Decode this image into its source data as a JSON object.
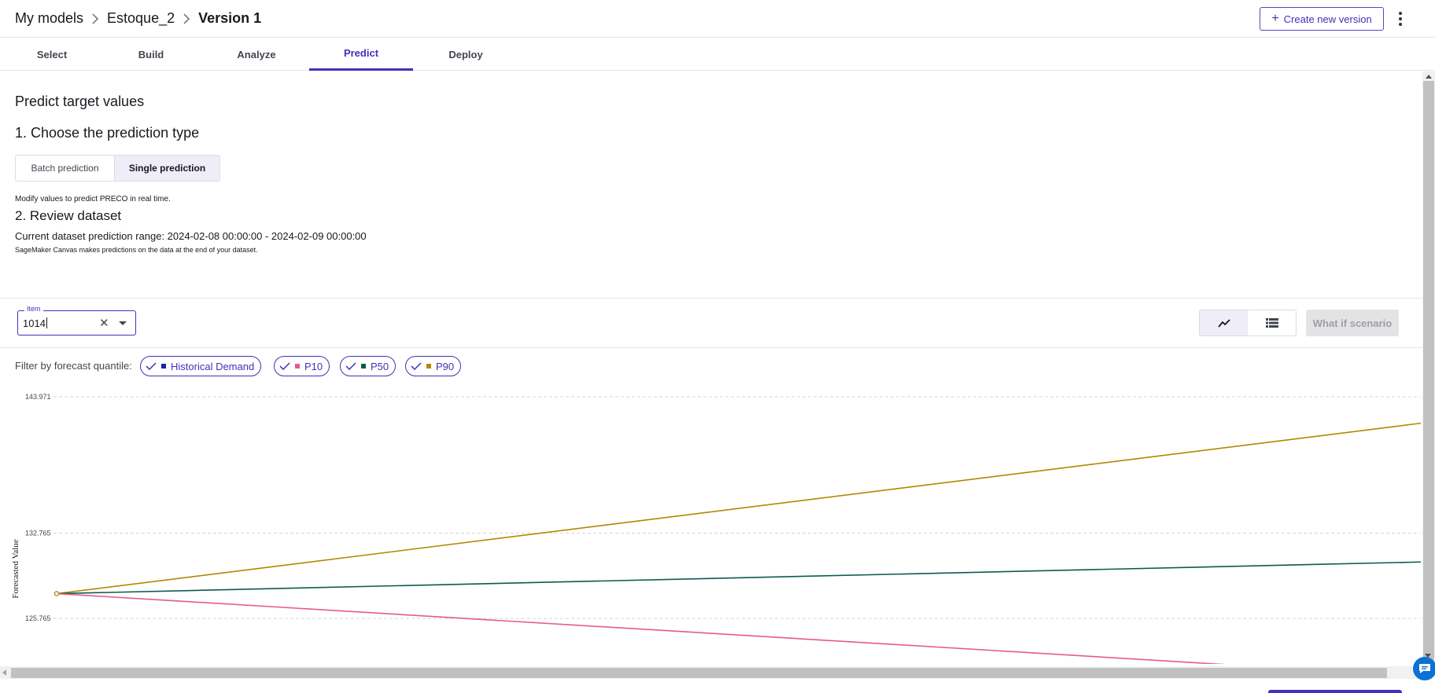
{
  "breadcrumb": {
    "root": "My models",
    "model": "Estoque_2",
    "version": "Version 1"
  },
  "header": {
    "create_button": "Create new version"
  },
  "tabs": [
    {
      "label": "Select"
    },
    {
      "label": "Build"
    },
    {
      "label": "Analyze"
    },
    {
      "label": "Predict",
      "active": true
    },
    {
      "label": "Deploy"
    }
  ],
  "content": {
    "title": "Predict target values",
    "step1": "1. Choose the prediction type",
    "prediction_types": {
      "batch": "Batch prediction",
      "single": "Single prediction",
      "selected": "Single prediction"
    },
    "hint": "Modify values to predict PRECO in real time.",
    "step2": "2. Review dataset",
    "range": "Current dataset prediction range: 2024-02-08 00:00:00 - 2024-02-09 00:00:00",
    "note": "SageMaker Canvas makes predictions on the data at the end of your dataset."
  },
  "item_filter": {
    "label": "Item",
    "value": "1014"
  },
  "view_toggle": {
    "selected": "chart-view"
  },
  "what_if_button": "What if scenario",
  "filter": {
    "label": "Filter by forecast quantile:",
    "chips": [
      {
        "label": "Historical Demand",
        "color": "#1f1fa8"
      },
      {
        "label": "P10",
        "color": "#e8588d"
      },
      {
        "label": "P50",
        "color": "#0b5a52"
      },
      {
        "label": "P90",
        "color": "#b08a00"
      }
    ]
  },
  "chart_data": {
    "type": "line",
    "ylabel": "Forecasted Value",
    "ytick_labels": [
      "143.971",
      "132.765",
      "125.765"
    ],
    "ytick_values": [
      143.971,
      132.765,
      125.765
    ],
    "ylim": [
      122.8,
      143.971
    ],
    "grid": true,
    "series": [
      {
        "name": "P90",
        "color": "#b08a00",
        "values": [
          127.8,
          141.8
        ]
      },
      {
        "name": "P50",
        "color": "#0b5a52",
        "values": [
          127.8,
          130.4
        ]
      },
      {
        "name": "P10",
        "color": "#e8588d",
        "values": [
          127.8,
          121.0
        ]
      }
    ],
    "historical_point": {
      "name": "Historical Demand",
      "value": 127.8
    }
  }
}
